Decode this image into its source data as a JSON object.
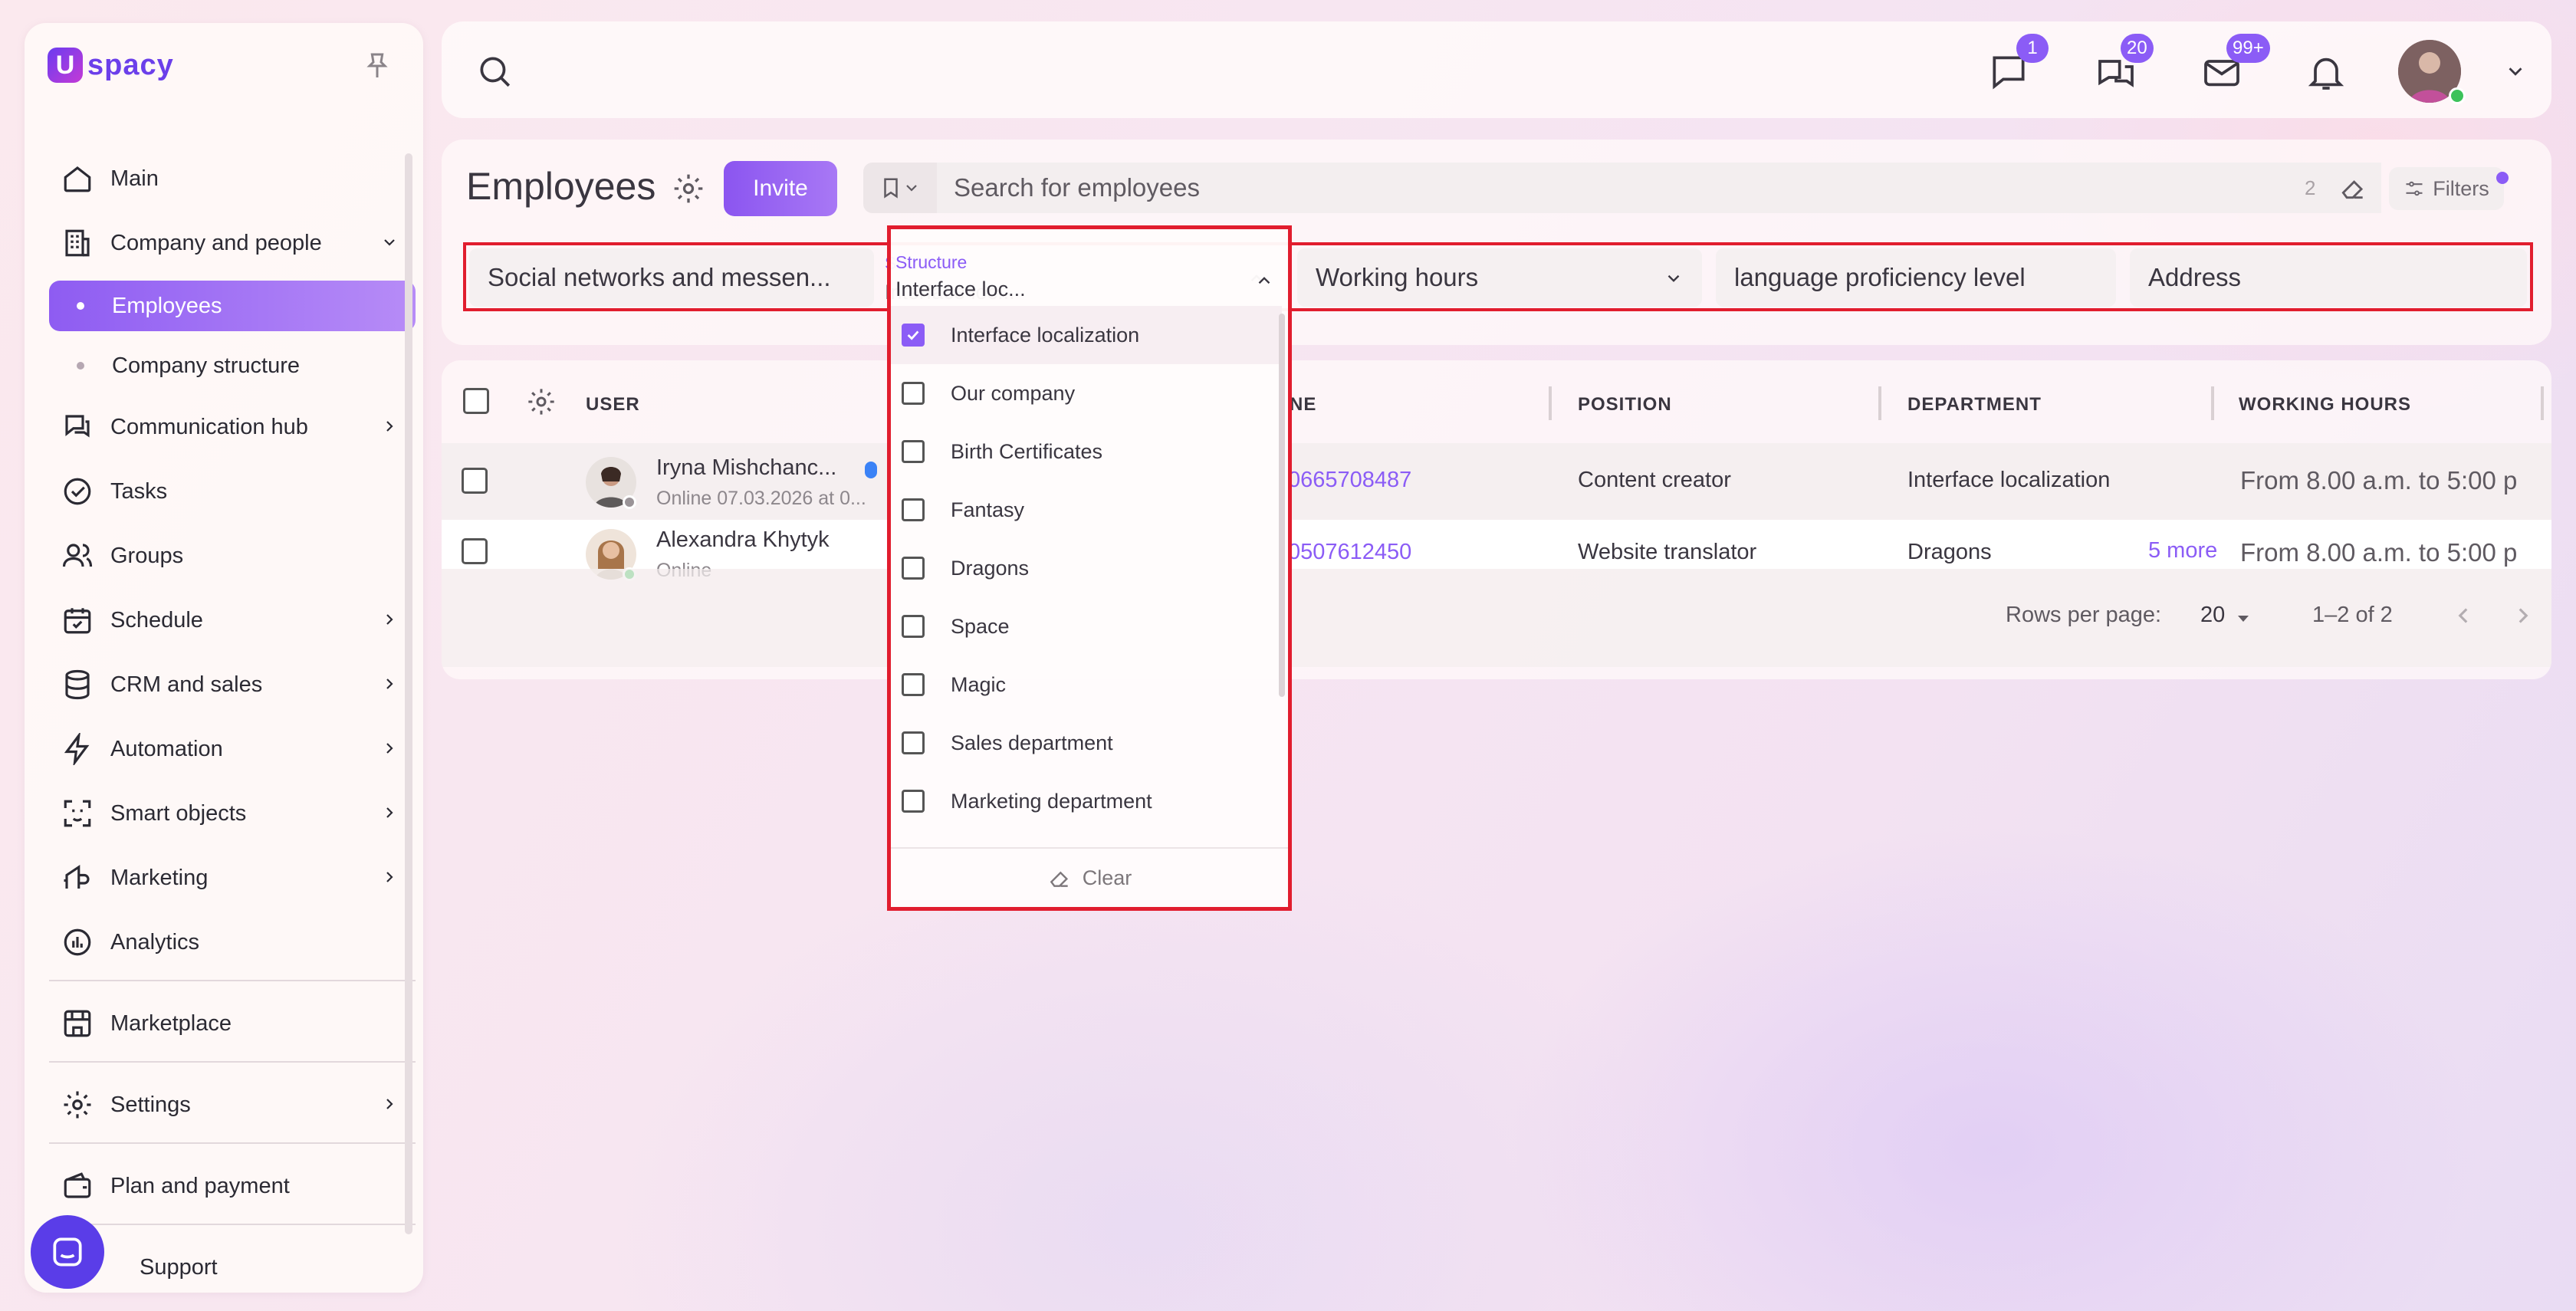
{
  "brand": {
    "logo_letter": "U",
    "logo_text": "spacy"
  },
  "sidebar": {
    "items": [
      {
        "label": "Main",
        "icon": "home-icon"
      },
      {
        "label": "Company and people",
        "icon": "building-icon",
        "expanded": true
      },
      {
        "label": "Employees",
        "sub": true,
        "active": true
      },
      {
        "label": "Company structure",
        "sub": true
      },
      {
        "label": "Communication hub",
        "icon": "chat-hub-icon",
        "chevron": true
      },
      {
        "label": "Tasks",
        "icon": "check-circle-icon"
      },
      {
        "label": "Groups",
        "icon": "users-icon"
      },
      {
        "label": "Schedule",
        "icon": "calendar-icon",
        "chevron": true
      },
      {
        "label": "CRM and sales",
        "icon": "database-icon",
        "chevron": true
      },
      {
        "label": "Automation",
        "icon": "lightning-icon",
        "chevron": true
      },
      {
        "label": "Smart objects",
        "icon": "scan-face-icon",
        "chevron": true
      },
      {
        "label": "Marketing",
        "icon": "megaphone-icon",
        "chevron": true
      },
      {
        "label": "Analytics",
        "icon": "chart-circle-icon"
      }
    ],
    "marketplace": "Marketplace",
    "settings": "Settings",
    "plan": "Plan and payment",
    "support": "Support"
  },
  "topbar": {
    "messages_badge": "1",
    "chats_badge": "20",
    "mail_badge": "99+"
  },
  "page": {
    "title": "Employees",
    "invite": "Invite",
    "search_placeholder": "Search for employees",
    "search_count": "2",
    "filters": "Filters"
  },
  "filters": {
    "social": "Social networks and messen...",
    "structure_label": "Structure",
    "structure_value": "Interface loc...",
    "working_hours": "Working hours",
    "language": "language proficiency level",
    "address": "Address"
  },
  "structure_options": [
    {
      "label": "Interface localization",
      "checked": true
    },
    {
      "label": "Our company",
      "checked": false
    },
    {
      "label": "Birth Certificates",
      "checked": false
    },
    {
      "label": "Fantasy",
      "checked": false
    },
    {
      "label": "Dragons",
      "checked": false
    },
    {
      "label": "Space",
      "checked": false
    },
    {
      "label": "Magic",
      "checked": false
    },
    {
      "label": "Sales department",
      "checked": false
    },
    {
      "label": "Marketing department",
      "checked": false
    }
  ],
  "dropdown": {
    "clear": "Clear"
  },
  "table": {
    "headers": {
      "user": "USER",
      "phone": "NE",
      "position": "POSITION",
      "department": "DEPARTMENT",
      "working_hours": "WORKING HOURS"
    },
    "rows": [
      {
        "name": "Iryna Mishchanc...",
        "status": "Online 07.03.2026 at 0...",
        "phone": "0665708487",
        "position": "Content creator",
        "department": "Interface localization",
        "more": "",
        "hours": "From 8.00 a.m. to 5:00 p"
      },
      {
        "name": "Alexandra Khytyk",
        "status": "Online",
        "phone": "0507612450",
        "position": "Website translator",
        "department": "Dragons",
        "more": "5 more",
        "hours": "From 8.00 a.m. to 5:00 p"
      }
    ],
    "rows_per_page_label": "Rows per page:",
    "rows_per_page": "20",
    "range": "1–2 of 2"
  },
  "colors": {
    "accent": "#8b5cf6",
    "highlight_border": "#e11d2e"
  }
}
